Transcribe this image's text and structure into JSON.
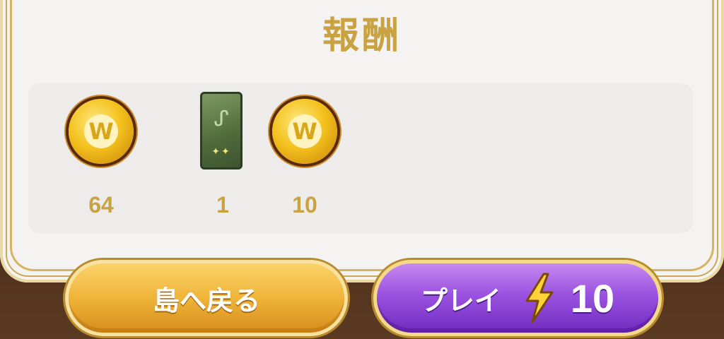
{
  "title": "報酬",
  "rewards": [
    {
      "icon": "gold-coin-icon",
      "count": "64"
    },
    {
      "icon": "green-card-pack-icon",
      "count": "1"
    },
    {
      "icon": "gold-coin-icon",
      "count": "10"
    }
  ],
  "buttons": {
    "back_label": "島へ戻る",
    "play_label": "プレイ",
    "play_cost": "10",
    "play_cost_icon": "lightning-bolt-icon"
  },
  "colors": {
    "accent_gold": "#c9a342",
    "back_button": "#efb43a",
    "play_button": "#9b52e0"
  }
}
